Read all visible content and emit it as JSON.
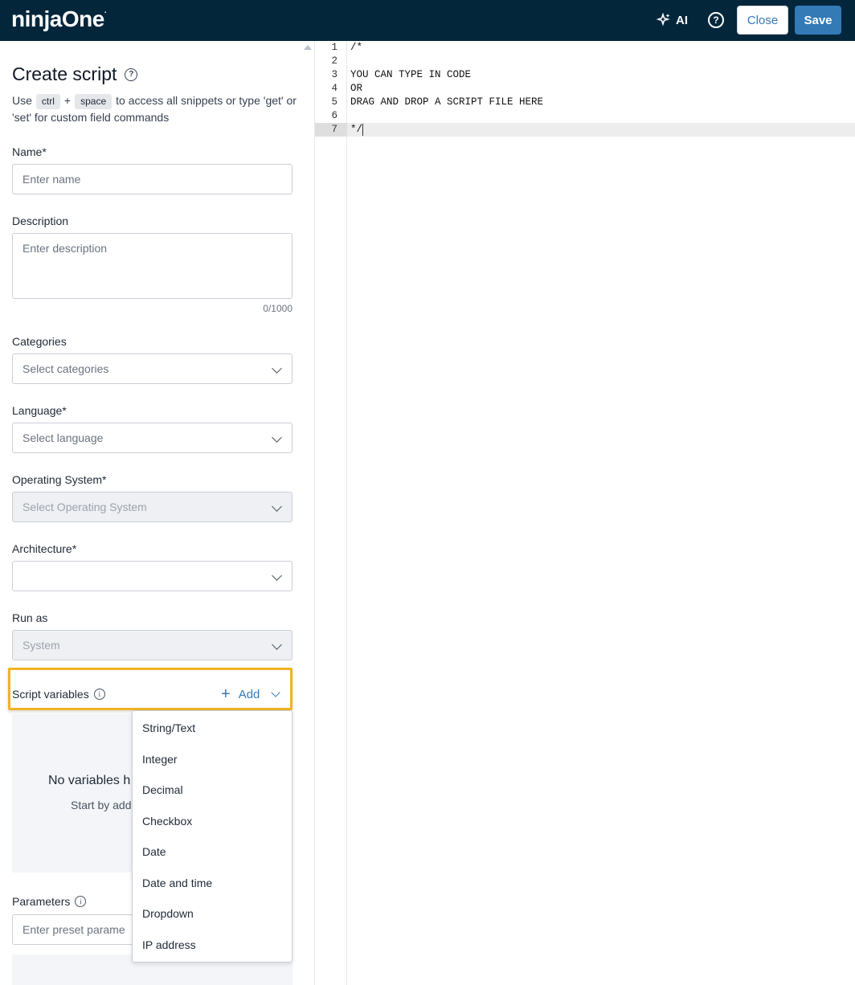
{
  "header": {
    "logo": "ninjaOne",
    "logo_mark": ".",
    "ai_label": "AI",
    "help": "?",
    "close_label": "Close",
    "save_label": "Save"
  },
  "form": {
    "title": "Create script",
    "hint_use": "Use",
    "kbd_ctrl": "ctrl",
    "plus": "+",
    "kbd_space": "space",
    "hint_rest": "to access all snippets or type 'get' or 'set' for custom field commands",
    "name_label": "Name*",
    "name_placeholder": "Enter name",
    "description_label": "Description",
    "description_placeholder": "Enter description",
    "description_counter": "0/1000",
    "categories_label": "Categories",
    "categories_value": "Select categories",
    "language_label": "Language*",
    "language_value": "Select language",
    "os_label": "Operating System*",
    "os_value": "Select Operating System",
    "arch_label": "Architecture*",
    "arch_value": "",
    "runas_label": "Run as",
    "runas_value": "System",
    "script_vars_label": "Script variables",
    "add_label": "Add",
    "empty_title": "No variables h",
    "empty_sub": "Start by add",
    "params_label": "Parameters",
    "params_placeholder": "Enter preset parame"
  },
  "menu": {
    "items": [
      "String/Text",
      "Integer",
      "Decimal",
      "Checkbox",
      "Date",
      "Date and time",
      "Dropdown",
      "IP address"
    ]
  },
  "editor": {
    "line_numbers": [
      "1",
      "2",
      "3",
      "4",
      "5",
      "6",
      "7"
    ],
    "lines": [
      "/*",
      "",
      "YOU CAN TYPE IN CODE",
      "OR",
      "DRAG AND DROP A SCRIPT FILE HERE",
      "",
      "*/"
    ]
  }
}
